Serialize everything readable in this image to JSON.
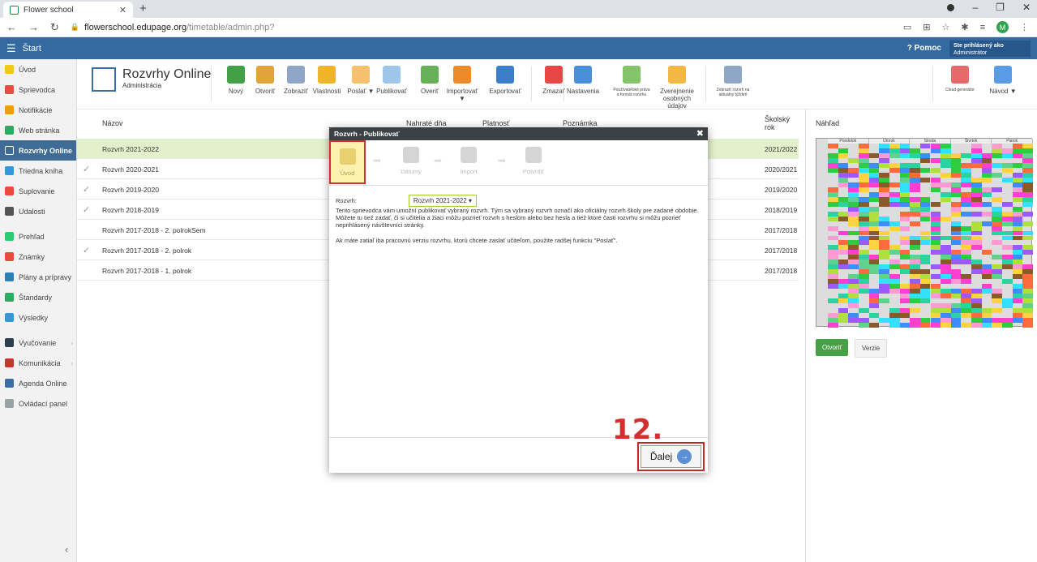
{
  "browser": {
    "tab_title": "Flower school",
    "url_host": "flowerschool.edupage.org",
    "url_path": "/timetable/admin.php?"
  },
  "topbar": {
    "start": "Štart",
    "help": "Pomoc",
    "user_line1": "Ste prihlásený ako",
    "user_line2": "Administrátor"
  },
  "sidebar": [
    {
      "label": "Úvod",
      "color": "#f5c518"
    },
    {
      "label": "Sprievodca",
      "color": "#e84c3d"
    },
    {
      "label": "Notifikácie",
      "color": "#f39c12"
    },
    {
      "label": "Web stránka",
      "color": "#27ae60"
    },
    {
      "label": "Rozvrhy Online",
      "color": "#ffffff",
      "active": true
    },
    {
      "label": "Triedna kniha",
      "color": "#3498db"
    },
    {
      "label": "Suplovanie",
      "color": "#e74c3c"
    },
    {
      "label": "Udalosti",
      "color": "#555555"
    },
    {
      "label": "Prehľad",
      "color": "#2ecc71"
    },
    {
      "label": "Známky",
      "color": "#e74c3c"
    },
    {
      "label": "Plány a prípravy",
      "color": "#2980b9"
    },
    {
      "label": "Štandardy",
      "color": "#27ae60"
    },
    {
      "label": "Výsledky",
      "color": "#3498db"
    },
    {
      "label": "Vyučovanie",
      "color": "#2c3e50",
      "arrow": true
    },
    {
      "label": "Komunikácia",
      "color": "#c0392b",
      "arrow": true
    },
    {
      "label": "Agenda Online",
      "color": "#3b6ea5"
    },
    {
      "label": "Ovládací panel",
      "color": "#95a5a6"
    }
  ],
  "brand": {
    "title": "Rozvrhy Online",
    "subtitle": "Administrácia"
  },
  "toolbar": [
    {
      "label": "Nový",
      "color": "#43a047"
    },
    {
      "label": "Otvoriť",
      "color": "#e0a43a"
    },
    {
      "label": "Zobraziť",
      "color": "#8fa6c7"
    },
    {
      "label": "Vlastnosti",
      "color": "#f0b429"
    },
    {
      "label": "Poslať ▼",
      "color": "#f5c16c"
    },
    {
      "label": "Publikovať",
      "color": "#9ec6ea"
    },
    {
      "label": "Overiť",
      "color": "#67b05a"
    },
    {
      "label": "Importovať ▼",
      "color": "#ed8b2b"
    },
    {
      "label": "Exportovať",
      "color": "#3c7ec9"
    },
    {
      "label": "Zmazať",
      "color": "#e94646"
    },
    {
      "label": "Nastavenia",
      "color": "#4a90d9"
    },
    {
      "label": "Používateľské práva a formát rozvrhu",
      "color": "#84c56b",
      "small": true
    },
    {
      "label": "Zverejnenie osobných údajov",
      "color": "#f3b844"
    },
    {
      "label": "Zobraziť rozvrh na aktuálny týždeň",
      "color": "#8fa6c7",
      "small": true
    },
    {
      "label": "Cloud generátor",
      "color": "#e56b6b",
      "small": true
    },
    {
      "label": "Návod ▼",
      "color": "#5a9be6"
    }
  ],
  "table": {
    "headers": {
      "name": "Názov",
      "uploaded": "Nahraté dňa",
      "valid": "Platnosť",
      "note": "Poznámka",
      "year": "Školský rok"
    },
    "rows": [
      {
        "name": "Rozvrh 2021-2022",
        "year": "2021/2022",
        "checked": false,
        "selected": true
      },
      {
        "name": "Rozvrh 2020-2021",
        "year": "2020/2021",
        "checked": true
      },
      {
        "name": "Rozvrh 2019-2020",
        "year": "2019/2020",
        "checked": true
      },
      {
        "name": "Rozvrh 2018-2019",
        "year": "2018/2019",
        "checked": true
      },
      {
        "name": "Rozvrh 2017-2018 - 2. polrokSem",
        "year": "2017/2018",
        "checked": false
      },
      {
        "name": "Rozvrh 2017-2018 - 2. polrok",
        "year": "2017/2018",
        "checked": true
      },
      {
        "name": "Rozvrh 2017-2018 - 1. polrok",
        "year": "2017/2018",
        "checked": false
      }
    ]
  },
  "preview": {
    "label": "Náhľad",
    "days": [
      "Pondelok",
      "Utorok",
      "Streda",
      "Štvrtok",
      "Piatok"
    ],
    "open": "Otvoriť",
    "versions": "Verzie"
  },
  "modal": {
    "title": "Rozvrh - Publikovať",
    "steps": [
      "Úvod",
      "Dátumy",
      "Import",
      "Potvrdiť"
    ],
    "field_label": "Rozvrh:",
    "field_value": "Rozvrh 2021-2022",
    "para1": "Tento sprievodca vám umožní publikovať vybraný rozvrh. Tým sa vybraný rozvrh označí ako oficiálny rozvrh školy pre zadané obdobie. Môžete tu tiež zadať, či si učitelia a žiaci môžu pozrieť rozvrh s heslom alebo bez hesla a tiež ktoré časti rozvrhu si môžu pozrieť neprihlásený návštevníci stránky.",
    "para2": "Ak máte zatiaľ iba pracovnú verziu rozvrhu, ktorú chcete zaslať učiteľom, použite radšej funkciu \"Poslať\".",
    "next": "Ďalej"
  },
  "annotation": "12."
}
